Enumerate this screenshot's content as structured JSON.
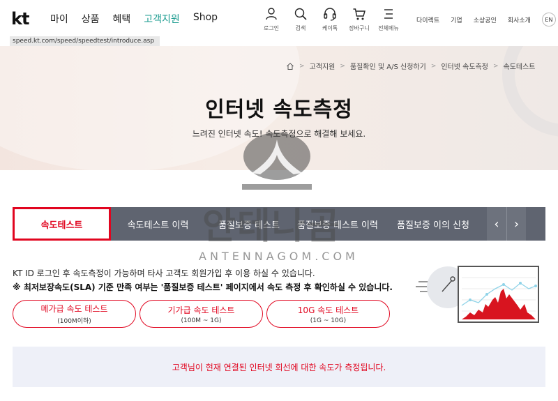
{
  "header": {
    "logo": "kt",
    "nav": [
      "마이",
      "상품",
      "혜택",
      "고객지원",
      "Shop"
    ],
    "active_nav_index": 3,
    "icons": [
      {
        "name": "user-icon",
        "label": "로그인"
      },
      {
        "name": "search-icon",
        "label": "검색"
      },
      {
        "name": "headset-icon",
        "label": "케이톡"
      },
      {
        "name": "cart-icon",
        "label": "장바구니"
      },
      {
        "name": "menu-icon",
        "label": "전체메뉴"
      }
    ],
    "util": [
      "다이렉트",
      "기업",
      "소상공인",
      "회사소개"
    ],
    "lang": "EN"
  },
  "url": "speed.kt.com/speed/speedtest/introduce.asp",
  "hero": {
    "breadcrumb": [
      "고객지원",
      "품질확인 및 A/S 신청하기",
      "인터넷 속도측정",
      "속도테스트"
    ],
    "title": "인터넷 속도측정",
    "subtitle": "느려진 인터넷 속도! 속도측정으로 해결해 보세요."
  },
  "watermark": {
    "text": "안테나곰",
    "site": "ANTENNAGOM.COM"
  },
  "tabs": [
    "속도테스트",
    "속도테스트 이력",
    "품질보증 테스트",
    "품질보증 테스트 이력",
    "품질보증 이의 신청"
  ],
  "active_tab_index": 0,
  "tab_arrows": {
    "prev": "‹",
    "next": "›"
  },
  "info": {
    "line1": "KT ID 로그인 후 속도측정이 가능하며 타사 고객도 회원가입 후 이용 하실 수 있습니다.",
    "line2": "※ 최저보장속도(SLA) 기준 만족 여부는 '품질보증 테스트' 페이지에서 속도 측정 후 확인하실 수 있습니다."
  },
  "test_buttons": [
    {
      "label": "메가급 속도 테스트",
      "sub": "(100M이하)"
    },
    {
      "label": "기가급 속도 테스트",
      "sub": "(100M ~ 1G)"
    },
    {
      "label": "10G 속도 테스트",
      "sub": "(1G ~ 10G)"
    }
  ],
  "notice": "고객님이 현재 연결된 인터넷 회선에 대한 속도가 측정됩니다.",
  "colors": {
    "brand_red": "#e1051f",
    "active_nav": "#1a9b8f",
    "tab_bg": "#5f6470",
    "notice_bg": "#eef0f8"
  }
}
